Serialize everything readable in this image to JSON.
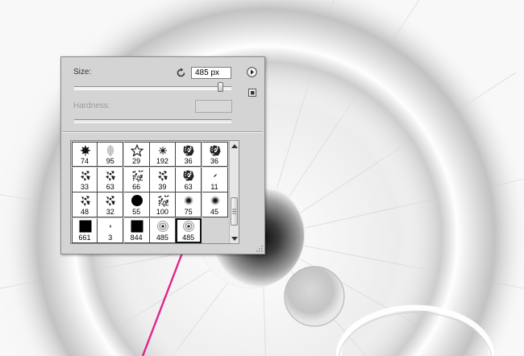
{
  "brush_panel": {
    "size_label": "Size:",
    "size_value": "485 px",
    "hardness_label": "Hardness:",
    "size_fraction": 0.93,
    "presets": [
      {
        "size": "74",
        "icon": "maple-leaf-icon"
      },
      {
        "size": "95",
        "icon": "leaf-icon"
      },
      {
        "size": "29",
        "icon": "star-outline-icon"
      },
      {
        "size": "192",
        "icon": "starburst-icon"
      },
      {
        "size": "36",
        "icon": "scatter-texture-icon"
      },
      {
        "size": "36",
        "icon": "scatter-texture-icon"
      },
      {
        "size": "33",
        "icon": "scatter-leaves-icon"
      },
      {
        "size": "63",
        "icon": "scatter-leaves-icon"
      },
      {
        "size": "66",
        "icon": "speckle-texture-icon"
      },
      {
        "size": "39",
        "icon": "scatter-leaves-icon"
      },
      {
        "size": "63",
        "icon": "scatter-texture-icon"
      },
      {
        "size": "11",
        "icon": "dash-icon"
      },
      {
        "size": "48",
        "icon": "scatter-leaves-icon"
      },
      {
        "size": "32",
        "icon": "scatter-leaves-icon"
      },
      {
        "size": "55",
        "icon": "hard-round-icon"
      },
      {
        "size": "100",
        "icon": "speckle-texture-icon"
      },
      {
        "size": "75",
        "icon": "soft-round-icon"
      },
      {
        "size": "45",
        "icon": "soft-round-icon"
      },
      {
        "size": "661",
        "icon": "square-icon"
      },
      {
        "size": "3",
        "icon": "dot-icon"
      },
      {
        "size": "844",
        "icon": "square-icon"
      },
      {
        "size": "485",
        "icon": "target-ring-icon"
      },
      {
        "size": "485",
        "icon": "target-ring-icon"
      }
    ],
    "selected_index": 22
  },
  "colors": {
    "annotation_arrow": "#e0238c",
    "panel_bg": "#d4d4d4"
  }
}
